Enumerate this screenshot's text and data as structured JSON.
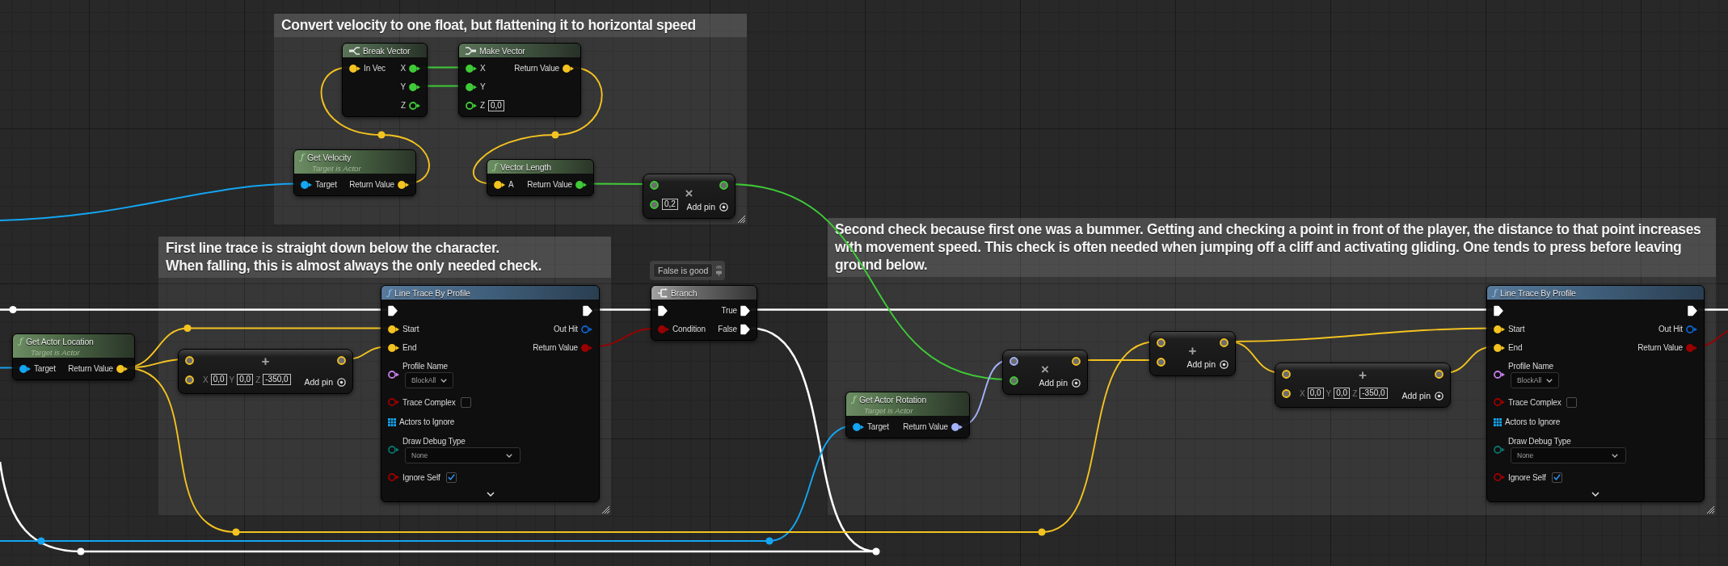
{
  "comments": [
    {
      "title": "Convert velocity to one float, but flattening it to horizontal speed"
    },
    {
      "title": "First line trace is straight down below the character.\nWhen falling, this is almost always the only needed check."
    },
    {
      "title": "Second check because first one was a bummer. Getting and checking a point in front of the player, the distance to that point increases\nwith movement speed. This check is often needed when jumping off a cliff and activating gliding. One tends to press before leaving\nground below."
    }
  ],
  "nodes": [
    {
      "kind": "break",
      "title": "Break Vector",
      "inputs": [
        {
          "kind": "pin",
          "color": "#f4c320",
          "label": "In Vec",
          "connected": true
        }
      ],
      "outputs": [
        {
          "kind": "pin",
          "color": "#3fcb37",
          "label": "X",
          "connected": true
        },
        {
          "kind": "pin",
          "color": "#3fcb37",
          "label": "Y",
          "connected": true
        },
        {
          "kind": "pin",
          "color": "#3fcb37",
          "label": "Z",
          "connected": false
        }
      ]
    },
    {
      "kind": "make",
      "title": "Make Vector",
      "inputs": [
        {
          "kind": "pin",
          "color": "#3fcb37",
          "label": "X",
          "connected": true
        },
        {
          "kind": "pin",
          "color": "#3fcb37",
          "label": "Y",
          "connected": true
        },
        {
          "kind": "pin",
          "color": "#3fcb37",
          "label": "Z",
          "connected": false,
          "value": "0,0"
        }
      ],
      "outputs": [
        {
          "kind": "pin",
          "color": "#f4c320",
          "label": "Return Value",
          "connected": true
        }
      ]
    },
    {
      "kind": "pure",
      "glyph": "ƒ",
      "title": "Get Velocity",
      "subtitle": "Target is Actor",
      "inputs": [
        {
          "kind": "pin",
          "color": "#14a6f2",
          "label": "Target",
          "connected": true
        }
      ],
      "outputs": [
        {
          "kind": "pin",
          "color": "#f4c320",
          "label": "Return Value",
          "connected": true
        }
      ]
    },
    {
      "kind": "pure",
      "glyph": "ƒ",
      "title": "Vector Length",
      "inputs": [
        {
          "kind": "pin",
          "color": "#f4c320",
          "label": "A",
          "connected": true
        }
      ],
      "outputs": [
        {
          "kind": "pin",
          "color": "#3fcb37",
          "label": "Return Value",
          "connected": true
        }
      ]
    },
    {
      "kind": "math",
      "symbol": "×",
      "inputs": [
        {
          "color": "#3fcb37"
        },
        {
          "color": "#3fcb37",
          "value": "0,2"
        }
      ],
      "outputs": [
        {
          "color": "#3fcb37"
        }
      ],
      "add_pin": "Add pin"
    },
    {
      "kind": "function",
      "glyph": "ƒ",
      "title": "Line Trace By Profile",
      "inputs": [
        {
          "kind": "exec",
          "connected": true
        },
        {
          "kind": "pin",
          "color": "#f4c320",
          "label": "Start",
          "connected": true
        },
        {
          "kind": "pin",
          "color": "#f4c320",
          "label": "End",
          "connected": true
        },
        {
          "kind": "dropdown",
          "color": "#c67ee9",
          "label": "Profile Name",
          "connected": false,
          "value": "BlockAll"
        },
        {
          "kind": "checkbox",
          "color": "#9b0000",
          "label": "Trace Complex",
          "connected": false,
          "checked": false
        },
        {
          "kind": "array",
          "color": "#14a6f2",
          "label": "Actors to Ignore"
        },
        {
          "kind": "dropdown",
          "color": "#0b716a",
          "label": "Draw Debug Type",
          "connected": false,
          "value": "None"
        },
        {
          "kind": "checkbox",
          "color": "#9b0000",
          "label": "Ignore Self",
          "connected": false,
          "checked": true
        }
      ],
      "outputs": [
        {
          "kind": "exec",
          "connected": true
        },
        {
          "kind": "pin",
          "color": "#0c60c6",
          "label": "Out Hit",
          "connected": false
        },
        {
          "kind": "pin",
          "color": "#9b0000",
          "label": "Return Value",
          "connected": true
        }
      ],
      "expanded": false
    },
    {
      "kind": "branch",
      "title": "Branch",
      "bubble": "False is good",
      "inputs": [
        {
          "kind": "exec",
          "connected": true
        },
        {
          "kind": "pin",
          "color": "#9b0000",
          "label": "Condition",
          "connected": true
        }
      ],
      "outputs": [
        {
          "kind": "exec",
          "label": "True",
          "connected": true
        },
        {
          "kind": "exec",
          "label": "False",
          "connected": true
        }
      ]
    },
    {
      "kind": "pure",
      "glyph": "ƒ",
      "title": "Get Actor Location",
      "subtitle": "Target is Actor",
      "inputs": [
        {
          "kind": "pin",
          "color": "#14a6f2",
          "label": "Target",
          "connected": true
        }
      ],
      "outputs": [
        {
          "kind": "pin",
          "color": "#f4c320",
          "label": "Return Value",
          "connected": true
        }
      ]
    },
    {
      "kind": "math",
      "symbol": "+",
      "inputs": [
        {
          "color": "#f4c320"
        },
        {
          "color": "#f4c320",
          "fields": [
            {
              "axis": "X",
              "value": "0,0"
            },
            {
              "axis": "Y",
              "value": "0,0"
            },
            {
              "axis": "Z",
              "value": "-350,0"
            }
          ]
        }
      ],
      "outputs": [
        {
          "color": "#f4c320"
        }
      ],
      "add_pin": "Add pin"
    },
    {
      "kind": "math",
      "symbol": "+",
      "inputs": [
        {
          "color": "#f4c320"
        },
        {
          "color": "#f4c320"
        }
      ],
      "outputs": [
        {
          "color": "#f4c320"
        }
      ],
      "add_pin": "Add pin"
    },
    {
      "kind": "math",
      "symbol": "×",
      "inputs": [
        {
          "color": "#a3b3fc"
        },
        {
          "color": "#3fcb37"
        }
      ],
      "outputs": [
        {
          "color": "#f4c320"
        }
      ],
      "add_pin": "Add pin"
    },
    {
      "kind": "math",
      "symbol": "+",
      "inputs": [
        {
          "color": "#f4c320"
        },
        {
          "color": "#f4c320",
          "fields": [
            {
              "axis": "X",
              "value": "0,0"
            },
            {
              "axis": "Y",
              "value": "0,0"
            },
            {
              "axis": "Z",
              "value": "-350,0"
            }
          ]
        }
      ],
      "outputs": [
        {
          "color": "#f4c320"
        }
      ],
      "add_pin": "Add pin"
    },
    {
      "kind": "pure",
      "glyph": "ƒ",
      "title": "Get Actor Rotation",
      "subtitle": "Target is Actor",
      "inputs": [
        {
          "kind": "pin",
          "color": "#14a6f2",
          "label": "Target",
          "connected": true
        }
      ],
      "outputs": [
        {
          "kind": "pin",
          "color": "#a3b3fc",
          "label": "Return Value",
          "connected": true
        }
      ]
    },
    {
      "kind": "function",
      "glyph": "ƒ",
      "title": "Line Trace By Profile",
      "inputs": [
        {
          "kind": "exec",
          "connected": true
        },
        {
          "kind": "pin",
          "color": "#f4c320",
          "label": "Start",
          "connected": true
        },
        {
          "kind": "pin",
          "color": "#f4c320",
          "label": "End",
          "connected": true
        },
        {
          "kind": "dropdown",
          "color": "#c67ee9",
          "label": "Profile Name",
          "connected": false,
          "value": "BlockAll"
        },
        {
          "kind": "checkbox",
          "color": "#9b0000",
          "label": "Trace Complex",
          "connected": false,
          "checked": false
        },
        {
          "kind": "array",
          "color": "#14a6f2",
          "label": "Actors to Ignore"
        },
        {
          "kind": "dropdown",
          "color": "#0b716a",
          "label": "Draw Debug Type",
          "connected": false,
          "value": "None"
        },
        {
          "kind": "checkbox",
          "color": "#9b0000",
          "label": "Ignore Self",
          "connected": false,
          "checked": true
        }
      ],
      "outputs": [
        {
          "kind": "exec",
          "connected": true
        },
        {
          "kind": "pin",
          "color": "#0c60c6",
          "label": "Out Hit",
          "connected": false
        },
        {
          "kind": "pin",
          "color": "#9b0000",
          "label": "Return Value",
          "connected": true
        }
      ],
      "expanded": false
    }
  ]
}
